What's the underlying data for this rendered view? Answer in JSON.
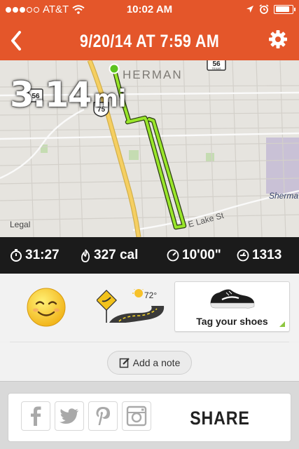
{
  "status_bar": {
    "carrier": "AT&T",
    "time": "10:02 AM",
    "signal_bars_filled": 3,
    "signal_bars_total": 5,
    "battery_level": 0.85
  },
  "nav": {
    "title": "9/20/14 AT 7:59 AM",
    "back_icon": "chevron-left-icon",
    "settings_icon": "gear-icon"
  },
  "map": {
    "distance_value": "3.14",
    "distance_unit": "mi",
    "legal": "Legal",
    "labels": {
      "city": "HERMAN",
      "city_right": "Sherma",
      "street": "E Lake St",
      "highway_75": "75",
      "highway_56_left": "56",
      "highway_56_right": "56",
      "shield_state": "TEXAS"
    },
    "route_color": "#99e62a",
    "start_marker_color": "#5cc31f"
  },
  "stats": {
    "duration": "31:27",
    "calories": "327 cal",
    "pace": "10'00\"",
    "fuel": "1313"
  },
  "details": {
    "mood_icon": "smiley-face-icon",
    "terrain_icon": "road-sign-icon",
    "temperature": "72°",
    "shoes_label": "Tag your shoes"
  },
  "note": {
    "label": "Add a note"
  },
  "share": {
    "label": "SHARE",
    "icons": [
      "facebook-icon",
      "twitter-icon",
      "pinterest-icon",
      "instagram-icon"
    ]
  },
  "colors": {
    "brand": "#e4562a",
    "stats_bg": "#1b1b1b",
    "accent_green": "#8dc63f"
  }
}
